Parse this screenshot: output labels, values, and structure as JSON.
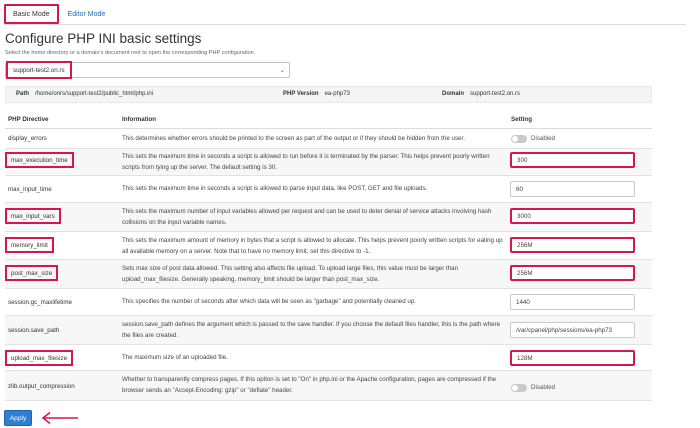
{
  "tabs": [
    {
      "label": "Basic Mode",
      "active": true
    },
    {
      "label": "Editor Mode",
      "active": false
    }
  ],
  "page": {
    "title": "Configure PHP INI basic settings",
    "subtitle": "Select the home directory or a domain's document root to open the corresponding PHP configuration."
  },
  "domain_select": {
    "value": "support-test2.on.rs"
  },
  "info_bar": {
    "path_label": "Path",
    "path_value": "/home/onrs/support-test2/public_html/php.ini",
    "version_label": "PHP Version",
    "version_value": "ea-php73",
    "domain_label": "Domain",
    "domain_value": "support-test2.on.rs"
  },
  "table": {
    "headers": {
      "directive": "PHP Directive",
      "information": "Information",
      "setting": "Setting"
    },
    "rows": [
      {
        "directive": "display_errors",
        "info": "This determines whether errors should be printed to the screen as part of the output or if they should be hidden from the user.",
        "type": "toggle",
        "value": "Disabled"
      },
      {
        "directive": "max_execution_time",
        "info": "This sets the maximum time in seconds a script is allowed to run before it is terminated by the parser. This helps prevent poorly written scripts from tying up the server. The default setting is 30.",
        "type": "input",
        "value": "300"
      },
      {
        "directive": "max_input_time",
        "info": "This sets the maximum time in seconds a script is allowed to parse input data, like POST, GET and file uploads.",
        "type": "input",
        "value": "60"
      },
      {
        "directive": "max_input_vars",
        "info": "This sets the maximum number of input variables allowed per request and can be used to deter denial of service attacks involving hash collisions on the input variable names.",
        "type": "input",
        "value": "3000"
      },
      {
        "directive": "memory_limit",
        "info": "This sets the maximum amount of memory in bytes that a script is allowed to allocate. This helps prevent poorly written scripts for eating up all available memory on a server. Note that to have no memory limit, set this directive to -1.",
        "type": "input",
        "value": "256M"
      },
      {
        "directive": "post_max_size",
        "info": "Sets max size of post data allowed. This setting also affects file upload. To upload large files, this value must be larger than upload_max_filesize. Generally speaking, memory_limit should be larger than post_max_size.",
        "type": "input",
        "value": "256M"
      },
      {
        "directive": "session.gc_maxlifetime",
        "info": "This specifies the number of seconds after which data will be seen as \"garbage\" and potentially cleaned up.",
        "type": "input",
        "value": "1440"
      },
      {
        "directive": "session.save_path",
        "info": "session.save_path defines the argument which is passed to the save handler. If you choose the default files handler, this is the path where the files are created.",
        "type": "input",
        "value": "/var/cpanel/php/sessions/ea-php73"
      },
      {
        "directive": "upload_max_filesize",
        "info": "The maximum size of an uploaded file.",
        "type": "input",
        "value": "128M"
      },
      {
        "directive": "zlib.output_compression",
        "info": "Whether to transparently compress pages. If this option is set to \"On\" in php.ini or the Apache configuration, pages are compressed if the browser sends an \"Accept-Encoding: gzip\" or \"deflate\" header.",
        "type": "toggle",
        "value": "Disabled"
      }
    ]
  },
  "apply_button": {
    "label": "Apply"
  },
  "colors": {
    "highlight": "#d6174f",
    "link": "#1c6fb8",
    "primary": "#2d7fd0",
    "row_alt": "#f7f7f7"
  },
  "icons": {
    "select_chevron": "chevron-down-icon",
    "apply_arrow": "arrow-left-icon"
  }
}
